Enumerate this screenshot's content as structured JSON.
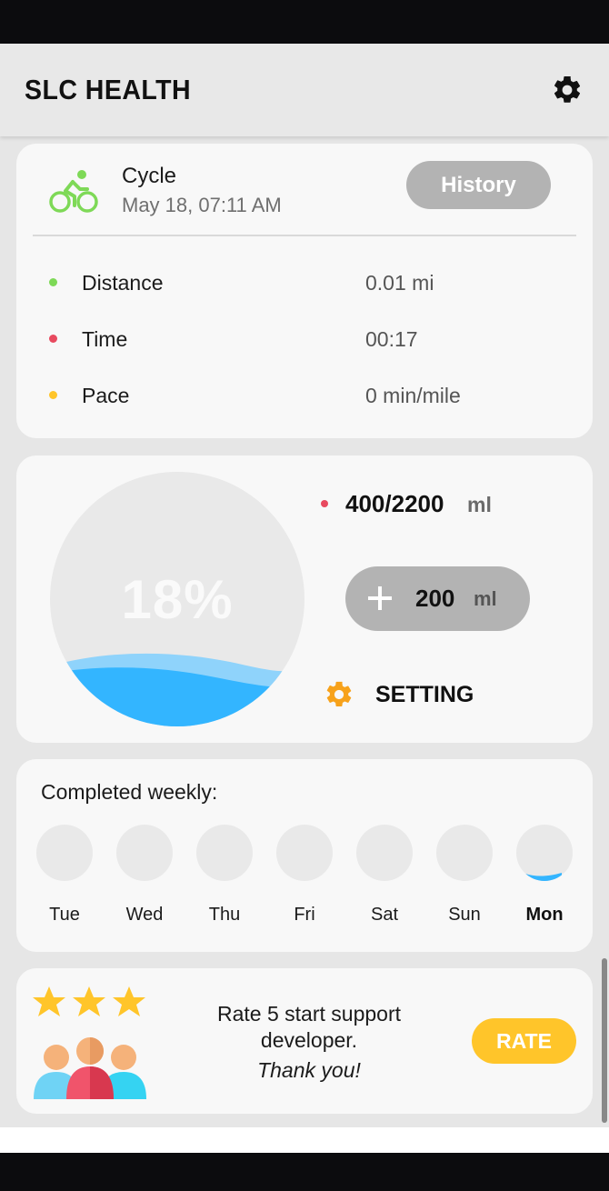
{
  "app": {
    "title": "SLC HEALTH",
    "settings_icon": "gear-icon"
  },
  "activity": {
    "name": "Cycle",
    "date": "May 18, 07:11 AM",
    "icon": "bicycle-icon",
    "history_label": "History",
    "stats": [
      {
        "label": "Distance",
        "value": "0.01  mi",
        "color": "#7ed957"
      },
      {
        "label": "Time",
        "value": "00:17",
        "color": "#e84a5f"
      },
      {
        "label": "Pace",
        "value": "0  min/mile",
        "color": "#ffc52a"
      }
    ]
  },
  "water": {
    "percent_label": "18%",
    "percent": 18,
    "intake": "400/2200",
    "unit": "ml",
    "add_amount": "200",
    "add_unit": "ml",
    "setting_label": "SETTING",
    "wave_color": "#33b5ff"
  },
  "weekly": {
    "title": "Completed weekly:",
    "days": [
      {
        "label": "Tue",
        "progress": 0
      },
      {
        "label": "Wed",
        "progress": 0
      },
      {
        "label": "Thu",
        "progress": 0
      },
      {
        "label": "Fri",
        "progress": 0
      },
      {
        "label": "Sat",
        "progress": 0
      },
      {
        "label": "Sun",
        "progress": 0
      },
      {
        "label": "Mon",
        "progress": 0.05,
        "today": true
      }
    ]
  },
  "rate": {
    "line1": "Rate 5 start support",
    "line2": "developer.",
    "thanks": "Thank you!",
    "button": "RATE",
    "stars": 3,
    "accent": "#ffc52a"
  }
}
